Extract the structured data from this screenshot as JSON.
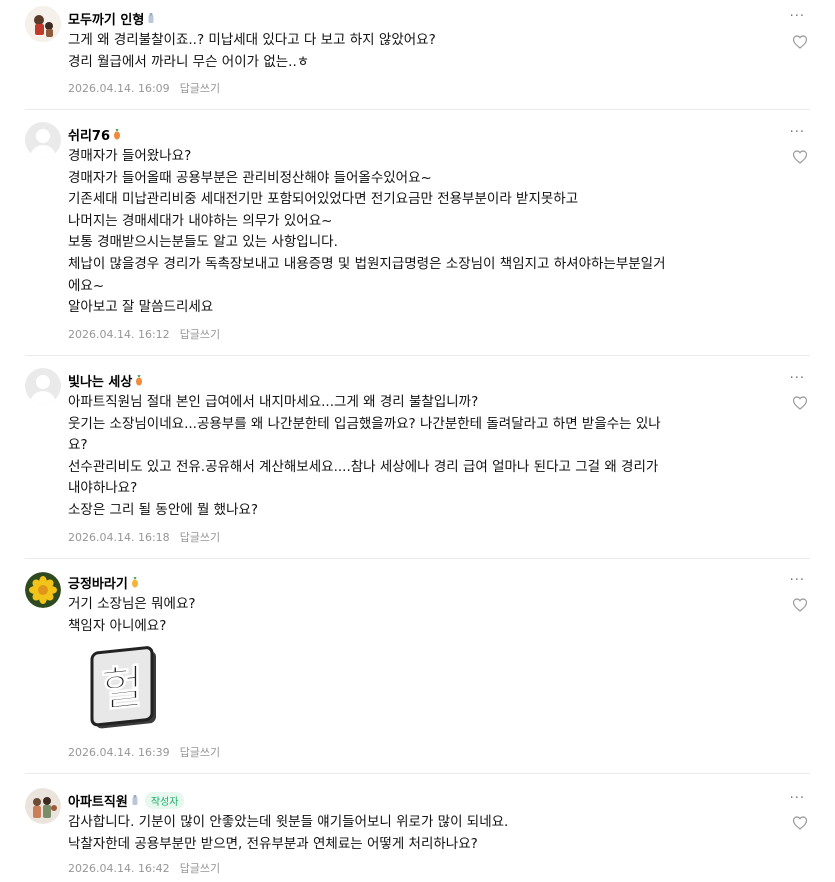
{
  "comments": [
    {
      "nickname": "모두까기 인형",
      "lines": "그게 왜 경리불찰이죠..? 미납세대 있다고 다 보고 하지 않았어요?\n경리 월급에서 까라니 무슨 어이가 없는..ㅎ",
      "date": "2026.04.14. 16:09",
      "reply": "답글쓰기",
      "grade_color": "#b9c7d8",
      "avatar": "character-avatar"
    },
    {
      "nickname": "쉬리76",
      "lines": "경매자가 들어왔나요?\n경매자가 들어올때 공용부분은 관리비정산해야 들어올수있어요~\n기존세대 미납관리비중 세대전기만 포함되어있었다면 전기요금만 전용부분이라 받지못하고\n나머지는 경매세대가 내야하는 의무가 있어요~\n보통 경매받으시는분들도 알고 있는 사항입니다.\n체납이 많을경우 경리가 독촉장보내고 내용증명 및 법원지급명령은 소장님이 책임지고 하셔야하는부분일거\n에요~\n알아보고 잘 말씀드리세요",
      "date": "2026.04.14. 16:12",
      "reply": "답글쓰기",
      "grade_color": "#f08a3c",
      "avatar": "default-avatar"
    },
    {
      "nickname": "빛나는 세상",
      "lines": "아파트직원님 절대 본인 급여에서 내지마세요...그게 왜 경리 불찰입니까?\n웃기는 소장님이네요...공용부를 왜 나간분한테 입금했을까요? 나간분한테 돌려달라고 하면 받을수는 있나\n요?\n선수관리비도 있고 전유.공유해서 계산해보세요....참나 세상에나 경리 급여 얼마나 된다고 그걸 왜 경리가\n내야하나요?\n소장은 그리 될 동안에 뭘 했나요?",
      "date": "2026.04.14. 16:18",
      "reply": "답글쓰기",
      "grade_color": "#f08a3c",
      "avatar": "default-avatar"
    },
    {
      "nickname": "긍정바라기",
      "lines": "거기 소장님은 뭐에요?\n책임자 아니에요?",
      "date": "2026.04.14. 16:39",
      "reply": "답글쓰기",
      "grade_color": "#f4b63a",
      "avatar": "flower-avatar",
      "sticker": "헐"
    },
    {
      "nickname": "아파트직원",
      "badge": "작성자",
      "lines": "감사합니다. 기분이 많이 안좋았는데 윗분들 얘기들어보니 위로가 많이 되네요.\n낙찰자한데 공용부분만 받으면, 전유부분과 연체료는 어떻게 처리하나요?",
      "date": "2026.04.14. 16:42",
      "reply": "답글쓰기",
      "grade_color": "#b9c7d8",
      "avatar": "photo-avatar"
    }
  ],
  "more_label": "···"
}
